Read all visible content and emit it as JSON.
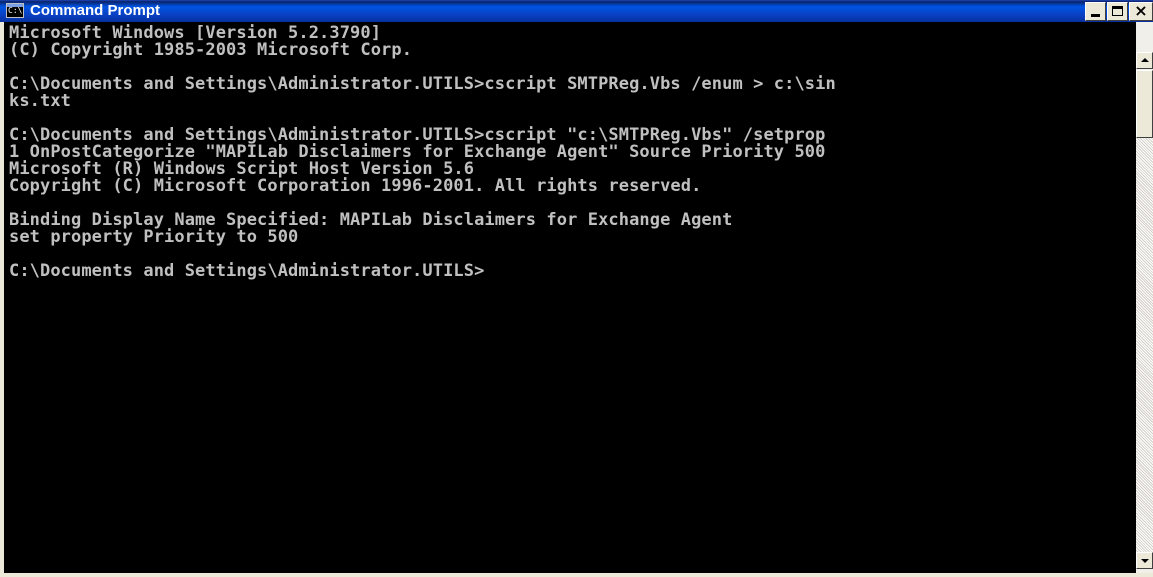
{
  "window": {
    "title": "Command Prompt",
    "icon_text": "C:\\",
    "close_symbol": "×"
  },
  "console": {
    "lines": [
      "Microsoft Windows [Version 5.2.3790]",
      "(C) Copyright 1985-2003 Microsoft Corp.",
      "",
      "C:\\Documents and Settings\\Administrator.UTILS>cscript SMTPReg.Vbs /enum > c:\\sin",
      "ks.txt",
      "",
      "C:\\Documents and Settings\\Administrator.UTILS>cscript \"c:\\SMTPReg.Vbs\" /setprop",
      "1 OnPostCategorize \"MAPILab Disclaimers for Exchange Agent\" Source Priority 500",
      "Microsoft (R) Windows Script Host Version 5.6",
      "Copyright (C) Microsoft Corporation 1996-2001. All rights reserved.",
      "",
      "Binding Display Name Specified: MAPILab Disclaimers for Exchange Agent",
      "set property Priority to 500",
      "",
      "C:\\Documents and Settings\\Administrator.UTILS>"
    ]
  },
  "colors": {
    "titlebar": "#0054e3",
    "console_bg": "#000000",
    "console_text": "#c0c0c0",
    "chrome": "#ece9d8"
  },
  "icons": {
    "app": "command-prompt-icon",
    "minimize": "minimize-icon",
    "maximize": "maximize-icon",
    "close": "close-icon",
    "scroll_up": "arrow-up-icon",
    "scroll_down": "arrow-down-icon"
  }
}
